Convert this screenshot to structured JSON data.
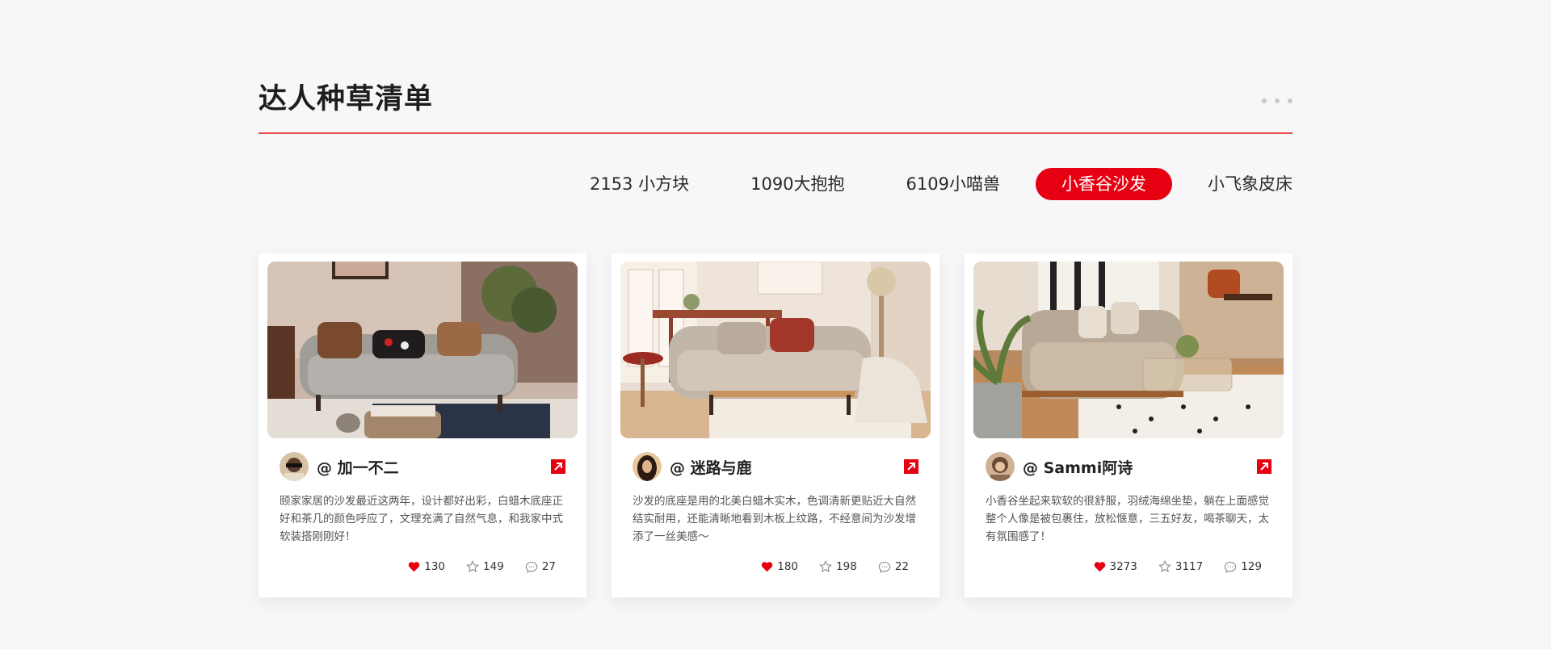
{
  "section": {
    "title": "达人种草清单"
  },
  "tabs": [
    {
      "label": "2153 小方块",
      "active": false
    },
    {
      "label": "1090大抱抱",
      "active": false
    },
    {
      "label": "6109小喵兽",
      "active": false
    },
    {
      "label": "小香谷沙发",
      "active": true
    },
    {
      "label": "小飞象皮床",
      "active": false
    }
  ],
  "colors": {
    "accent": "#e60012",
    "divider": "#e84a4a",
    "heart": "#e60012"
  },
  "cards": [
    {
      "username": "@ 加一不二",
      "description": "颐家家居的沙发最近这两年，设计都好出彩，白蜡木底座正好和茶几的颜色呼应了，文理充满了自然气息，和我家中式软装搭刚刚好！",
      "likes": "130",
      "stars": "149",
      "comments": "27"
    },
    {
      "username": "@  迷路与鹿",
      "description": "沙发的底座是用的北美白蜡木实木，色调清新更贴近大自然结实耐用，还能清晰地看到木板上纹路，不经意间为沙发增添了一丝美感～",
      "likes": "180",
      "stars": "198",
      "comments": "22"
    },
    {
      "username": "@ Sammi阿诗",
      "description": "小香谷坐起来软软的很舒服，羽绒海绵坐垫，躺在上面感觉整个人像是被包裹住，放松惬意，三五好友，喝茶聊天，太有氛围感了！",
      "likes": "3273",
      "stars": "3117",
      "comments": "129"
    }
  ],
  "icons": {
    "more": "more-dots-icon",
    "share": "share-arrow-icon",
    "like": "heart-icon",
    "star": "star-icon",
    "comment": "comment-icon"
  }
}
